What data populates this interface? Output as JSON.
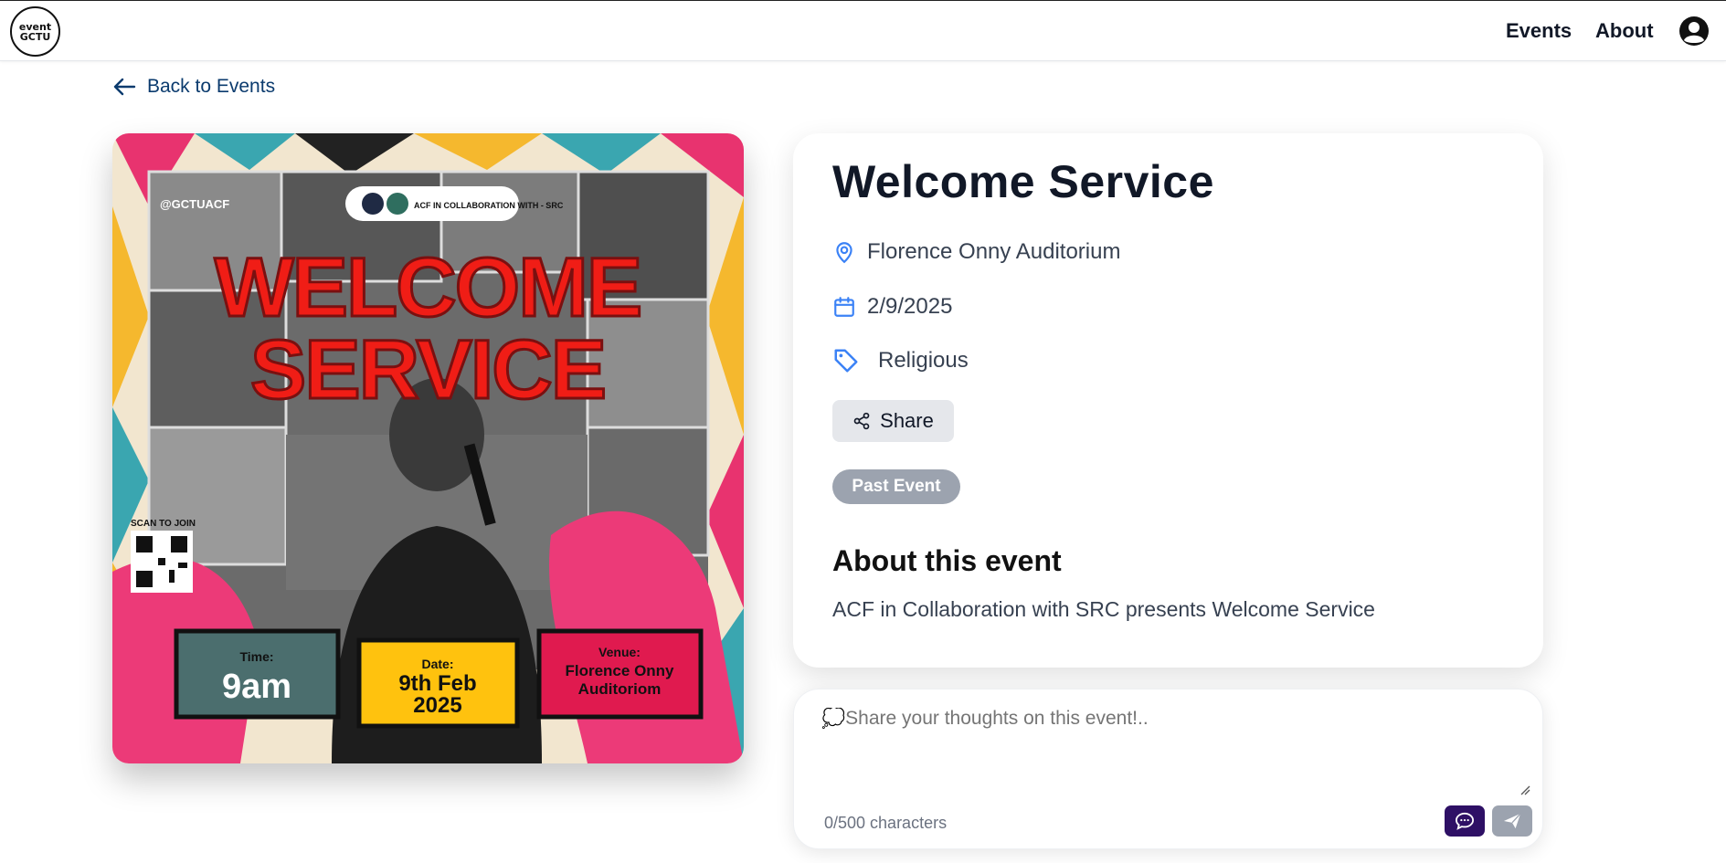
{
  "brand": {
    "logo_line1": "event",
    "logo_line2": "GCTU"
  },
  "nav": {
    "events": "Events",
    "about": "About",
    "profile_icon": "user-circle-icon"
  },
  "back_link": {
    "label": "Back to Events",
    "icon": "arrow-left-icon"
  },
  "poster": {
    "social": "@GCTUACF",
    "collab": "ACF IN COLLABORATION WITH - SRC",
    "headline1": "WELCOME",
    "headline2": "SERVICE",
    "scan": "SCAN TO JOIN",
    "time_label": "Time:",
    "time_value": "9am",
    "date_label": "Date:",
    "date_value1": "9th Feb",
    "date_value2": "2025",
    "venue_label": "Venue:",
    "venue_value1": "Florence Onny",
    "venue_value2": "Auditoriom"
  },
  "event": {
    "title": "Welcome Service",
    "location": "Florence Onny Auditorium",
    "date": "2/9/2025",
    "category": "Religious",
    "share_label": "Share",
    "status_badge": "Past Event",
    "about_heading": "About this event",
    "about_text": "ACF in Collaboration with SRC presents Welcome Service"
  },
  "comment": {
    "placeholder": "💭Share your thoughts on this event!..",
    "counter": "0/500 characters"
  },
  "colors": {
    "accent_blue": "#3b82f6",
    "chat_button": "#2e1065",
    "badge": "#9ca3af"
  }
}
